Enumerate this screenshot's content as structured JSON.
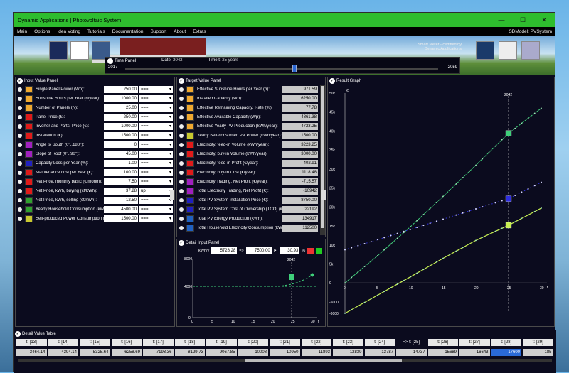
{
  "window": {
    "title": "Dynamic Applications | Photovoltaic System",
    "min": "—",
    "max": "☐",
    "close": "✕"
  },
  "menu": {
    "items": [
      "Main",
      "Options",
      "Idea Voting",
      "Tutorials",
      "Documentation",
      "Support",
      "About",
      "Extras"
    ],
    "model": "SDModel:  PVSystem"
  },
  "banner": {
    "meter_text1": "Smart Meter - certified by",
    "meter_text2": "Dynamic Applications"
  },
  "time_panel": {
    "title": "Time Panel",
    "date_label": "Date:",
    "date_value": "2042",
    "time_label": "Time t:",
    "time_value": "25  years",
    "start": "2017",
    "end": "2059",
    "position": 0.59
  },
  "input_panel": {
    "title": "Input Value Panel",
    "rows": [
      {
        "label": "Single Panel Power (Wp):",
        "value": "250.00",
        "opt": "===",
        "color": "#f0a830",
        "icon": "1"
      },
      {
        "label": "Sunshine Hours per Year (h/year):",
        "value": "1000.00",
        "opt": "===",
        "color": "#f0a830",
        "icon": "1"
      },
      {
        "label": "Number of Panels (N):",
        "value": "25.00",
        "opt": "===",
        "color": "#f0a830",
        "icon": "1"
      },
      {
        "label": "Panel Price (€):",
        "value": "250.00",
        "opt": "===",
        "color": "#e01a1a",
        "icon": ""
      },
      {
        "label": "Inverter and Parts, Price (€):",
        "value": "1000.00",
        "opt": "===",
        "color": "#e01a1a",
        "icon": ""
      },
      {
        "label": "Installation (€):",
        "value": "1500.00",
        "opt": "===",
        "color": "#e01a1a",
        "icon": ""
      },
      {
        "label": "Angle to South (0°..180°):",
        "value": "0",
        "opt": "===",
        "color": "#a020c0",
        "icon": ""
      },
      {
        "label": "Slope of Roof (0°..90°):",
        "value": "45.00",
        "opt": "===",
        "color": "#a020c0",
        "icon": ""
      },
      {
        "label": "Capacity Loss per Year (%):",
        "value": "1.00",
        "opt": "===",
        "color": "#2020c0",
        "icon": ""
      },
      {
        "label": "Maintenance cost per Year (€):",
        "value": "100.00",
        "opt": "===",
        "color": "#e01a1a",
        "icon": ""
      },
      {
        "label": "Net Price, monthly basic (€/month):",
        "value": "7.50",
        "opt": "===",
        "color": "#e01a1a",
        "icon": ""
      },
      {
        "label": "Net Price, kWh, buying (ct/kWh):",
        "value": "37.28",
        "opt": "up",
        "color": "#e01a1a",
        "icon": ""
      },
      {
        "label": "Net Price, kWh, selling (ct/kWh):",
        "value": "12.50",
        "opt": "===",
        "color": "#30a030",
        "icon": ""
      },
      {
        "label": "Yearly Household Consumption (kW",
        "value": "4500.00",
        "opt": "===",
        "color": "#30a030",
        "icon": ""
      },
      {
        "label": "Self-produced Power Consumption (",
        "value": "1500.00",
        "opt": "===",
        "color": "#c8c830",
        "icon": ""
      }
    ]
  },
  "target_panel": {
    "title": "Target Value Panel",
    "rows": [
      {
        "label": "Effective Sunshine Hours per Year (h):",
        "value": "971.59",
        "color": "#f0a830"
      },
      {
        "label": "Installed Capacity (Wp):",
        "value": "6250.00",
        "color": "#f0a830"
      },
      {
        "label": "Effective Remaining Capacity, Rate (%):",
        "value": "77.78",
        "color": "#f0a830"
      },
      {
        "label": "Effective Available Capacity (Wp):",
        "value": "4861.38",
        "color": "#f0a830"
      },
      {
        "label": "Effective Yearly PV Production (kWh/year):",
        "value": "4723.25",
        "color": "#f0a830"
      },
      {
        "label": "Yearly Self-consumed PV Power (kWh/year):",
        "value": "1500.00",
        "color": "#c8c830"
      },
      {
        "label": "Electricity, feed-in Volume (kWh/year):",
        "value": "3223.25",
        "color": "#e01a1a"
      },
      {
        "label": "Electricity, buy-in Volume (kWh/year):",
        "value": "3000.00",
        "color": "#e01a1a"
      },
      {
        "label": "Electricity, feed-in Profit (€/year):",
        "value": "402.91",
        "color": "#e01a1a"
      },
      {
        "label": "Electricity, buy-in Cost (€/year):",
        "value": "1118.48",
        "color": "#e01a1a"
      },
      {
        "label": "Electricity Trading, Net Profit (€/year):",
        "value": "-715.57",
        "color": "#a020c0"
      },
      {
        "label": "Total Electricity Trading, Net Profit (€):",
        "value": "-10942",
        "color": "#a020c0"
      },
      {
        "label": "Total PV System Installation Price (€):",
        "value": "8750.00",
        "color": "#2020c0"
      },
      {
        "label": "Total PV System Cost of Ownership (TCO) (€):",
        "value": "22192",
        "color": "#2020c0"
      },
      {
        "label": "Total PV Energy Production (kWh):",
        "value": "134917",
        "color": "#2060c0"
      },
      {
        "label": "Total Household Electricity Consumption (kW",
        "value": "112500",
        "color": "#2060c0"
      }
    ]
  },
  "detail_input": {
    "title": "Detail Input Panel",
    "unit": "kWh/y",
    "v1": "5728.28",
    "arrow": "=>",
    "v2": "7500.00",
    "op": "(•)",
    "v3": "30.93",
    "pct": "%",
    "year": "2042",
    "yticks": [
      "8000",
      "4000",
      "0"
    ],
    "xticks": [
      "0",
      "5",
      "10",
      "15",
      "20",
      "25",
      "30"
    ],
    "t": "t"
  },
  "result_graph": {
    "title": "Result Graph",
    "year": "2042",
    "unit": "€",
    "t": "t"
  },
  "chart_data": {
    "type": "line",
    "x": [
      0,
      5,
      10,
      15,
      20,
      25,
      30
    ],
    "ylim": [
      -8000,
      50000
    ],
    "yticks": [
      "50k",
      "45k",
      "40k",
      "35k",
      "30k",
      "25k",
      "20k",
      "15k",
      "10k",
      "5k",
      "0",
      "-5000",
      "-8000"
    ],
    "xticks": [
      "0",
      "5",
      "10",
      "15",
      "20",
      "25",
      "30"
    ],
    "series": [
      {
        "values": [
          0,
          7200,
          14800,
          22800,
          31000,
          39400,
          46000
        ],
        "color": "#3fcf7a"
      },
      {
        "values": [
          8750,
          11400,
          14100,
          16800,
          19500,
          22192,
          26500
        ],
        "color": "#2f2fe0"
      },
      {
        "values": [
          -8000,
          -3200,
          1600,
          6500,
          11200,
          15200,
          19700
        ],
        "color": "#c8f050"
      }
    ]
  },
  "detail_table": {
    "title": "Detail Value Table",
    "headers": [
      "t: [13]",
      "t: [14]",
      "t: [15]",
      "t: [16]",
      "t: [17]",
      "t: [18]",
      "t: [19]",
      "t: [20]",
      "t: [21]",
      "t: [22]",
      "t: [23]",
      "t: [24]",
      "=> t: [25]",
      "t: [26]",
      "t: [27]",
      "t: [28]",
      "t: [29]"
    ],
    "values": [
      "3464.14",
      "4394.14",
      "5325.64",
      "6258.69",
      "7193.36",
      "8129.73",
      "9067.85",
      "10008",
      "10950",
      "11893",
      "12839",
      "13787",
      "14737",
      "15689",
      "16643",
      "17600",
      "185"
    ]
  }
}
